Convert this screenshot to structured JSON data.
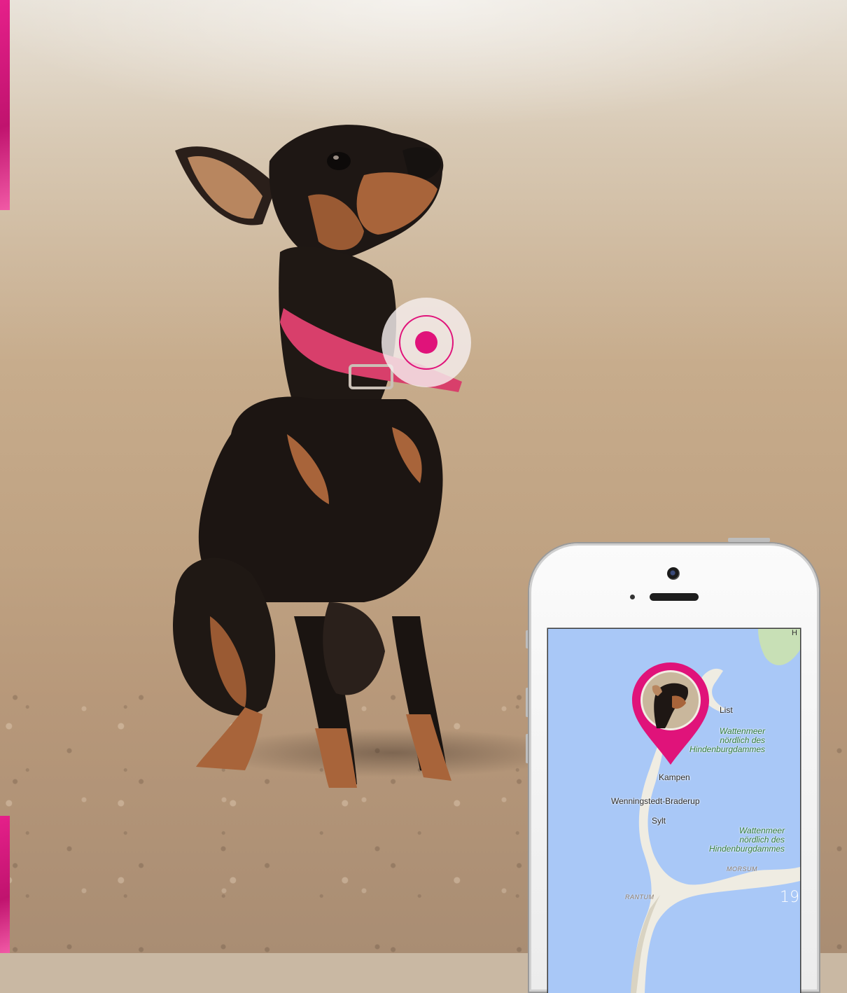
{
  "colors": {
    "brand_magenta": "#e0137a",
    "map_water": "#a9c8f7",
    "map_land": "#efece2"
  },
  "icons": {
    "tracker": "location-tracker-icon",
    "map_pin": "map-pin-icon"
  },
  "phone": {
    "map": {
      "corner_label": "H",
      "places": {
        "list": "List",
        "kampen": "Kampen",
        "wenningstedt": "Wenningstedt-Braderup",
        "sylt": "Sylt",
        "morsum": "MORSUM",
        "rantum": "RANTUM"
      },
      "water_label_1": "Wattenmeer\nnördlich des\nHindenburgdammes",
      "water_label_2": "Wattenmeer\nnördlich des\nHindenburgdammes"
    }
  },
  "page_number": "19"
}
